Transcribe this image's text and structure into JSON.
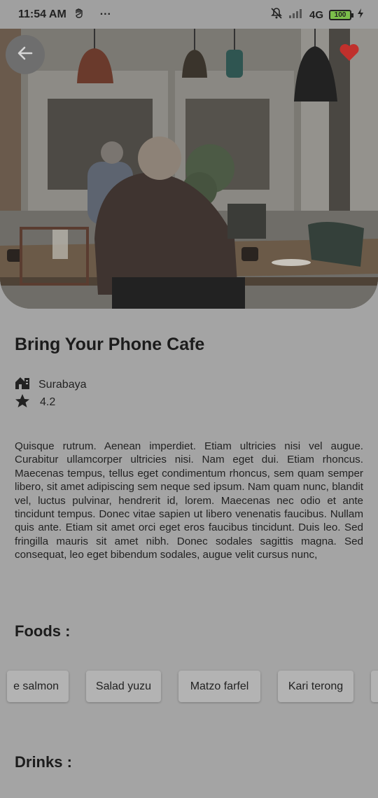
{
  "status_bar": {
    "time": "11:54 AM",
    "more": "···",
    "network": "4G",
    "battery": "100",
    "icons": [
      "hand-icon",
      "muted-bell-icon",
      "signal-icon",
      "battery-icon",
      "charging-icon"
    ]
  },
  "hero": {
    "image_description_icon": "cafe-photo",
    "back_icon": "arrow-left-icon",
    "favorite_icon": "heart-icon",
    "favorite_color": "#c0302c"
  },
  "detail": {
    "title": "Bring Your Phone Cafe",
    "location": "Surabaya",
    "rating": "4.2",
    "description": "Quisque rutrum. Aenean imperdiet. Etiam ultricies nisi vel augue. Curabitur ullamcorper ultricies nisi. Nam eget dui. Etiam rhoncus. Maecenas tempus, tellus eget condimentum rhoncus, sem quam semper libero, sit amet adipiscing sem neque sed ipsum. Nam quam nunc, blandit vel, luctus pulvinar, hendrerit id, lorem. Maecenas nec odio et ante tincidunt tempus. Donec vitae sapien ut libero venenatis faucibus. Nullam quis ante. Etiam sit amet orci eget eros faucibus tincidunt. Duis leo. Sed fringilla mauris sit amet nibh. Donec sodales sagittis magna. Sed consequat, leo eget bibendum sodales, augue velit cursus nunc,"
  },
  "foods": {
    "heading": "Foods :",
    "items": [
      "e salmon",
      "Salad yuzu",
      "Matzo farfel",
      "Kari terong"
    ]
  },
  "drinks": {
    "heading": "Drinks :"
  },
  "colors": {
    "overlay_bg": "#a4a4a4",
    "chip_bg": "#b3b3b3",
    "battery_fill": "#7bbf4a"
  }
}
